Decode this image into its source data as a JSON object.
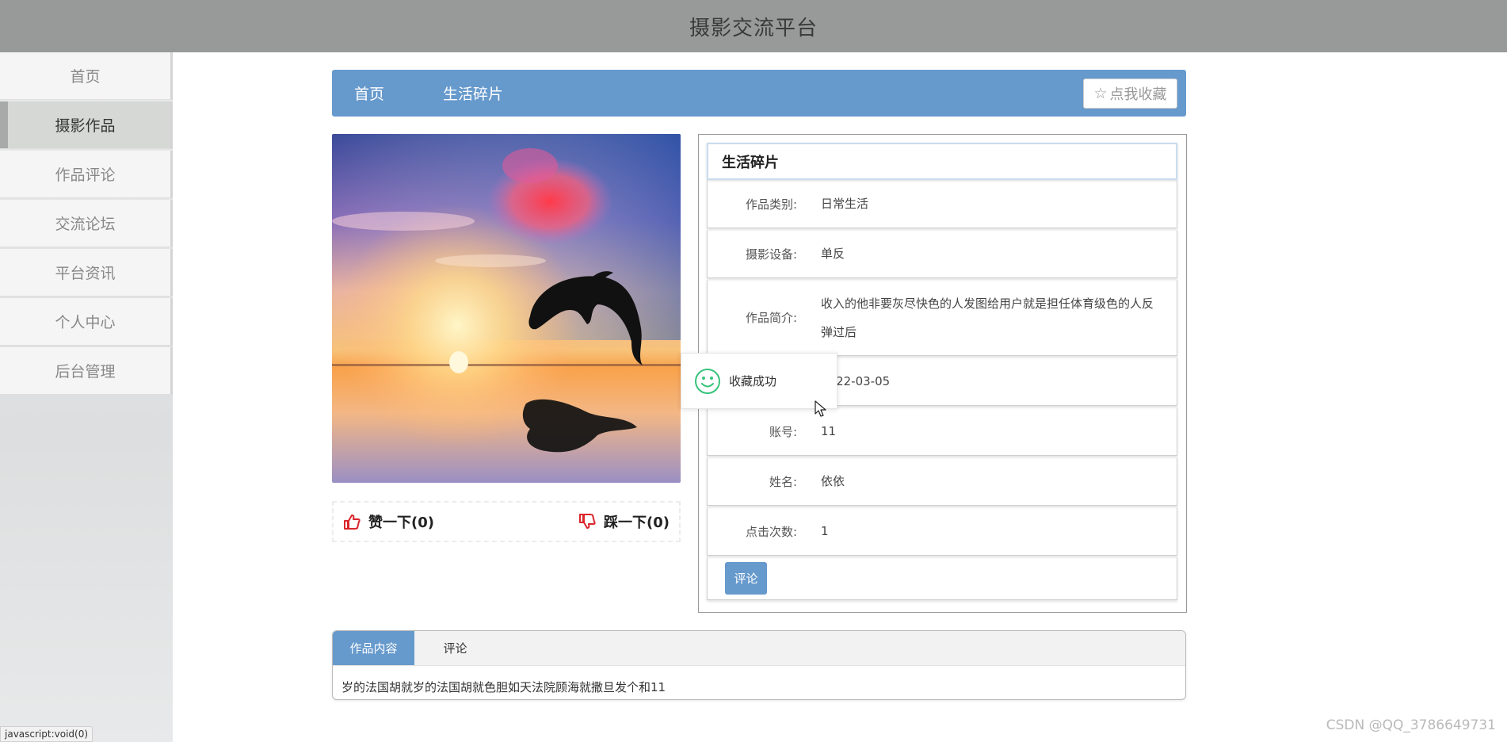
{
  "header": {
    "title": "摄影交流平台"
  },
  "sidebar": {
    "items": [
      {
        "label": "首页",
        "active": false
      },
      {
        "label": "摄影作品",
        "active": true
      },
      {
        "label": "作品评论",
        "active": false
      },
      {
        "label": "交流论坛",
        "active": false
      },
      {
        "label": "平台资讯",
        "active": false
      },
      {
        "label": "个人中心",
        "active": false
      },
      {
        "label": "后台管理",
        "active": false
      }
    ]
  },
  "breadcrumb": {
    "home": "首页",
    "current": "生活碎片",
    "favorite_label": "点我收藏",
    "favorite_icon": "star-outline-icon"
  },
  "photo": {
    "description_icon": "dolphin-sunset-photo"
  },
  "votes": {
    "like_label": "赞一下(0)",
    "dislike_label": "踩一下(0)"
  },
  "details": {
    "title": "生活碎片",
    "rows": [
      {
        "label": "作品类别:",
        "value": "日常生活"
      },
      {
        "label": "摄影设备:",
        "value": "单反"
      },
      {
        "label": "作品简介:",
        "value": "收入的他非要灰尽快色的人发图给用户就是担任体育级色的人反弹过后"
      },
      {
        "label": "",
        "value": "2022-03-05"
      },
      {
        "label": "账号:",
        "value": "11"
      },
      {
        "label": "姓名:",
        "value": "依依"
      },
      {
        "label": "点击次数:",
        "value": "1"
      }
    ],
    "comment_button": "评论"
  },
  "toast": {
    "message": "收藏成功"
  },
  "tabs": {
    "items": [
      "作品内容",
      "评论"
    ],
    "content": "岁的法国胡就岁的法国胡就色胆如天法院顾海就撒旦发个和11"
  },
  "status_bar": {
    "url": "javascript:void(0)"
  },
  "watermark": "CSDN @QQ_3786649731",
  "colors": {
    "accent": "#6699cc",
    "topbar": "#979a99"
  }
}
